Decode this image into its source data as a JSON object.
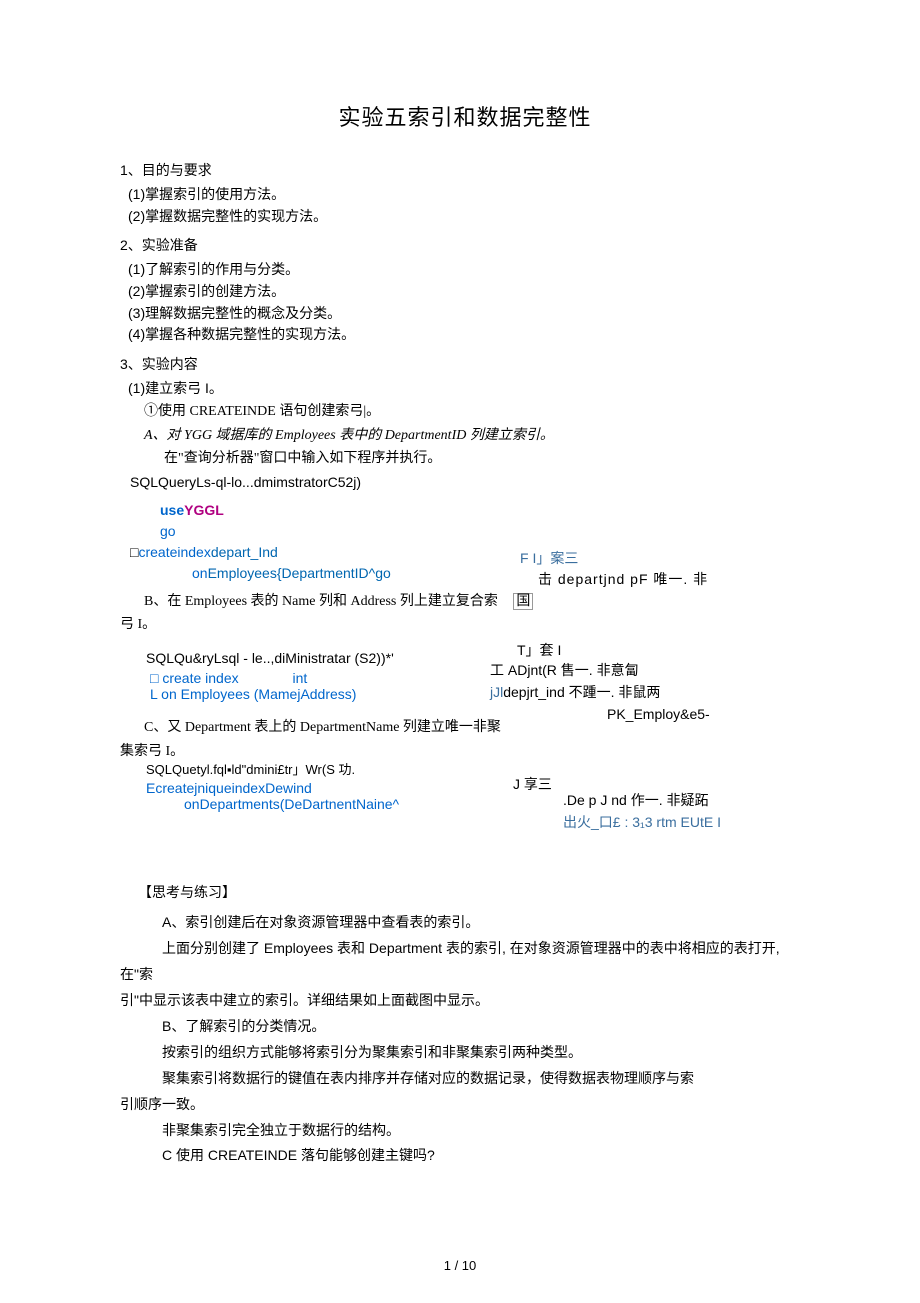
{
  "title": "实验五索引和数据完整性",
  "s1": {
    "head": "1、目的与要求",
    "i1": "(1)掌握索引的使用方法。",
    "i2": "(2)掌握数据完整性的实现方法。"
  },
  "s2": {
    "head": "2、实验准备",
    "i1": "(1)了解索引的作用与分类。",
    "i2": "(2)掌握索引的创建方法。",
    "i3": "(3)理解数据完整性的概念及分类。",
    "i4": "(4)掌握各种数据完整性的实现方法。"
  },
  "s3": {
    "head": "3、实验内容",
    "i1": "(1)建立索弓 I。",
    "step1": "①使用 CREATEINDE 语句创建索弓|。",
    "A_line": "A、对 YGG 域据库的 Employees 表中的 DepartmentID 列建立索引。",
    "A_note": "在\"查询分析器\"窗口中输入如下程序并执行。",
    "codeA_label": "SQLQueryLs-ql-lo...dmimstratorC52j)",
    "codeA": {
      "l1a": "use",
      "l1b": "YGGL",
      "l2": "go",
      "l3a": "□",
      "l3b": "createindex",
      "l3c": "depart_Ind",
      "l4a": "on",
      "l4b": "Employees{DepartmentID^go"
    },
    "sideA1": "F I」案三",
    "sideA2": "击 departjnd pF 唯一. 非",
    "B_line": "B、在 Employees 表的 Name 列和 Address 列上建立复合索",
    "B_line2": "弓 I。",
    "B_box": "国",
    "codeB_label": "SQLQu&ryLsql - le..,diMinistratar (S2))*'",
    "codeB": {
      "l1a": "□ create index",
      "l1b": "int",
      "l2a": "L on Employees (Mamej",
      "l2b": "Address)"
    },
    "sideB1": "T」套 I",
    "sideB2": "工 ADjnt(R 售一. 非意匐",
    "sideB3": "jJldepjrt_ind 不踵一. 非鼠两",
    "sideB4": "PK_Employ&e5-",
    "C_line": "C、又 Department 表上的 DepartmentName 列建立唯一非聚",
    "C_line2": "集索弓 I。",
    "codeC_label": "SQLQuetyl.fql▪ld\"dmini£tr」Wr(S 功.",
    "codeC": {
      "l1": "EcreatejniqueindexDewind",
      "l2": "onDepartments(DeDartnentNaine^"
    },
    "sideC1": "J 享三",
    "sideC2": ".De p J nd 作一. 非疑跖",
    "sideC3": "出火_口£ : 3₁3 rtm EUtE I"
  },
  "think": {
    "head": "【思考与练习】",
    "A1": "A、索引创建后在对象资源管理器中查看表的索引。",
    "A2": "上面分别创建了 Employees 表和 Department 表的索引, 在对象资源管理器中的表中将相应的表打开, 在\"索",
    "A3": "引\"中显示该表中建立的索引。详细结果如上面截图中显示。",
    "B1": "B、了解索引的分类情况。",
    "B2": "按索引的组织方式能够将索引分为聚集索引和非聚集索引两种类型。",
    "B3": "聚集索引将数据行的键值在表内排序并存储对应的数据记录，使得数据表物理顺序与索",
    "B4": "引顺序一致。",
    "B5": "非聚集索引完全独立于数据行的结构。",
    "C1": "C 使用 CREATEINDE 落句能够创建主键吗?"
  },
  "footer": "1 / 10"
}
